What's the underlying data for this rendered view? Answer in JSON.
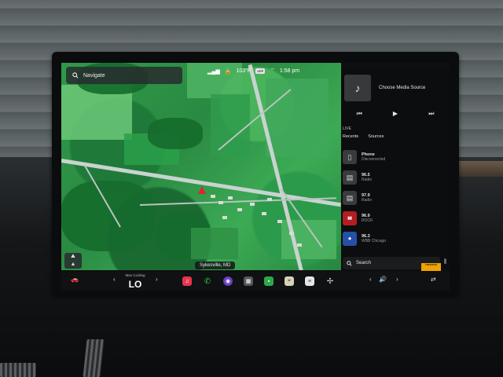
{
  "map": {
    "navigate_placeholder": "Navigate",
    "location_label": "Sykesville, MD"
  },
  "status_bar": {
    "temperature": "103°F",
    "airbag_badge": "OFF",
    "time": "1:58 pm"
  },
  "media": {
    "title": "Choose Media Source",
    "live_label": "LIVE",
    "tabs": [
      "Recents",
      "Sources"
    ],
    "items": [
      {
        "name": "Phone",
        "detail": "Disconnected",
        "icon": "phone-icon"
      },
      {
        "name": "96.5",
        "detail": "Radio",
        "icon": "radio-icon"
      },
      {
        "name": "97.9",
        "detail": "Radio",
        "icon": "radio-icon"
      },
      {
        "name": "96.9",
        "detail": "ROCK",
        "icon": "rock-station-logo"
      },
      {
        "name": "96.3",
        "detail": "WBB Chicago",
        "icon": "wbbm-station-logo"
      }
    ],
    "search_label": "Search",
    "sponsor_badge": "FREEDOM"
  },
  "dock": {
    "climate_label": "Max Cooling",
    "climate_value": "LO",
    "apps": [
      "music",
      "phone",
      "camera",
      "apps",
      "calendar",
      "maps",
      "notes",
      "fan"
    ]
  }
}
